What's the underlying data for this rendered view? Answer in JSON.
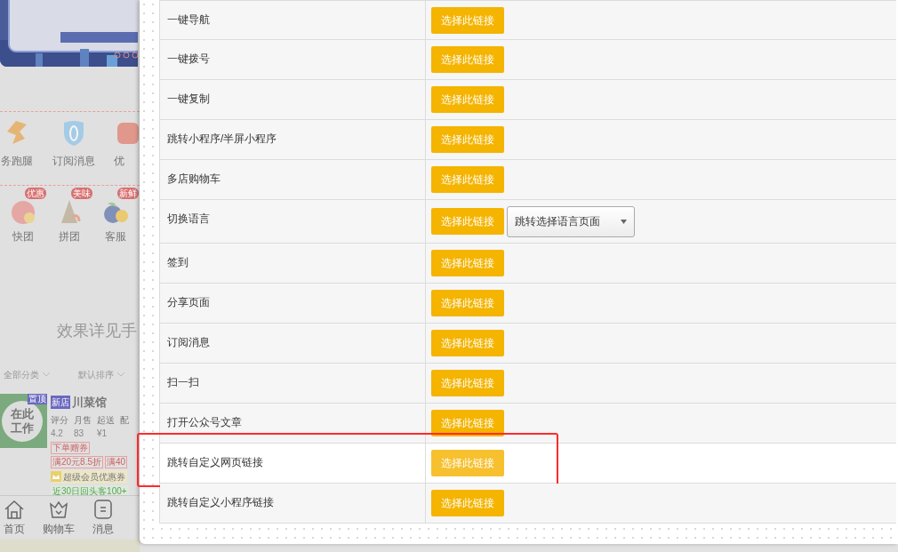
{
  "preview": {
    "quick_icons": [
      {
        "label": "务跑腿",
        "kind": "runner"
      },
      {
        "label": "订阅消息",
        "kind": "shield"
      },
      {
        "label": "优",
        "kind": "coupon"
      }
    ],
    "groups": [
      {
        "label": "快团",
        "badge": "优惠",
        "kind": "meat"
      },
      {
        "label": "拼团",
        "badge": "美味",
        "kind": "fish"
      },
      {
        "label": "客服",
        "badge": "新鲜",
        "kind": "berry"
      }
    ],
    "notice": "效果详见手",
    "filters": [
      "全部分类",
      "默认排序"
    ],
    "shop": {
      "logo_text": "在此工作",
      "pin_badge": "置顶",
      "new_badge": "新店",
      "name": "川菜馆",
      "stats": [
        {
          "label": "评分",
          "value": "4.2"
        },
        {
          "label": "月售",
          "value": "83"
        },
        {
          "label": "起送",
          "value": "¥1"
        },
        {
          "label": "配"
        }
      ],
      "tags": [
        "下单赠券",
        "满20元8.5折",
        "满40"
      ],
      "member_coupon": "超级会员优惠券",
      "highlights": [
        "近30日回头客100+"
      ]
    },
    "tab_bar": [
      {
        "label": "首页",
        "kind": "home"
      },
      {
        "label": "购物车",
        "kind": "basket"
      },
      {
        "label": "消息",
        "kind": "message"
      }
    ]
  },
  "links": [
    {
      "name": "一键导航",
      "button": "选择此链接",
      "highlighted": false
    },
    {
      "name": "一键拨号",
      "button": "选择此链接",
      "highlighted": false
    },
    {
      "name": "一键复制",
      "button": "选择此链接",
      "highlighted": false
    },
    {
      "name": "跳转小程序/半屏小程序",
      "button": "选择此链接",
      "highlighted": false
    },
    {
      "name": "多店购物车",
      "button": "选择此链接",
      "highlighted": false
    },
    {
      "name": "切换语言",
      "button": "选择此链接",
      "highlighted": false,
      "select": "跳转选择语言页面"
    },
    {
      "name": "签到",
      "button": "选择此链接",
      "highlighted": false
    },
    {
      "name": "分享页面",
      "button": "选择此链接",
      "highlighted": false
    },
    {
      "name": "订阅消息",
      "button": "选择此链接",
      "highlighted": false
    },
    {
      "name": "扫一扫",
      "button": "选择此链接",
      "highlighted": false
    },
    {
      "name": "打开公众号文章",
      "button": "选择此链接",
      "highlighted": false
    },
    {
      "name": "跳转自定义网页链接",
      "button": "选择此链接",
      "highlighted": true
    },
    {
      "name": "跳转自定义小程序链接",
      "button": "选择此链接",
      "highlighted": false
    }
  ]
}
